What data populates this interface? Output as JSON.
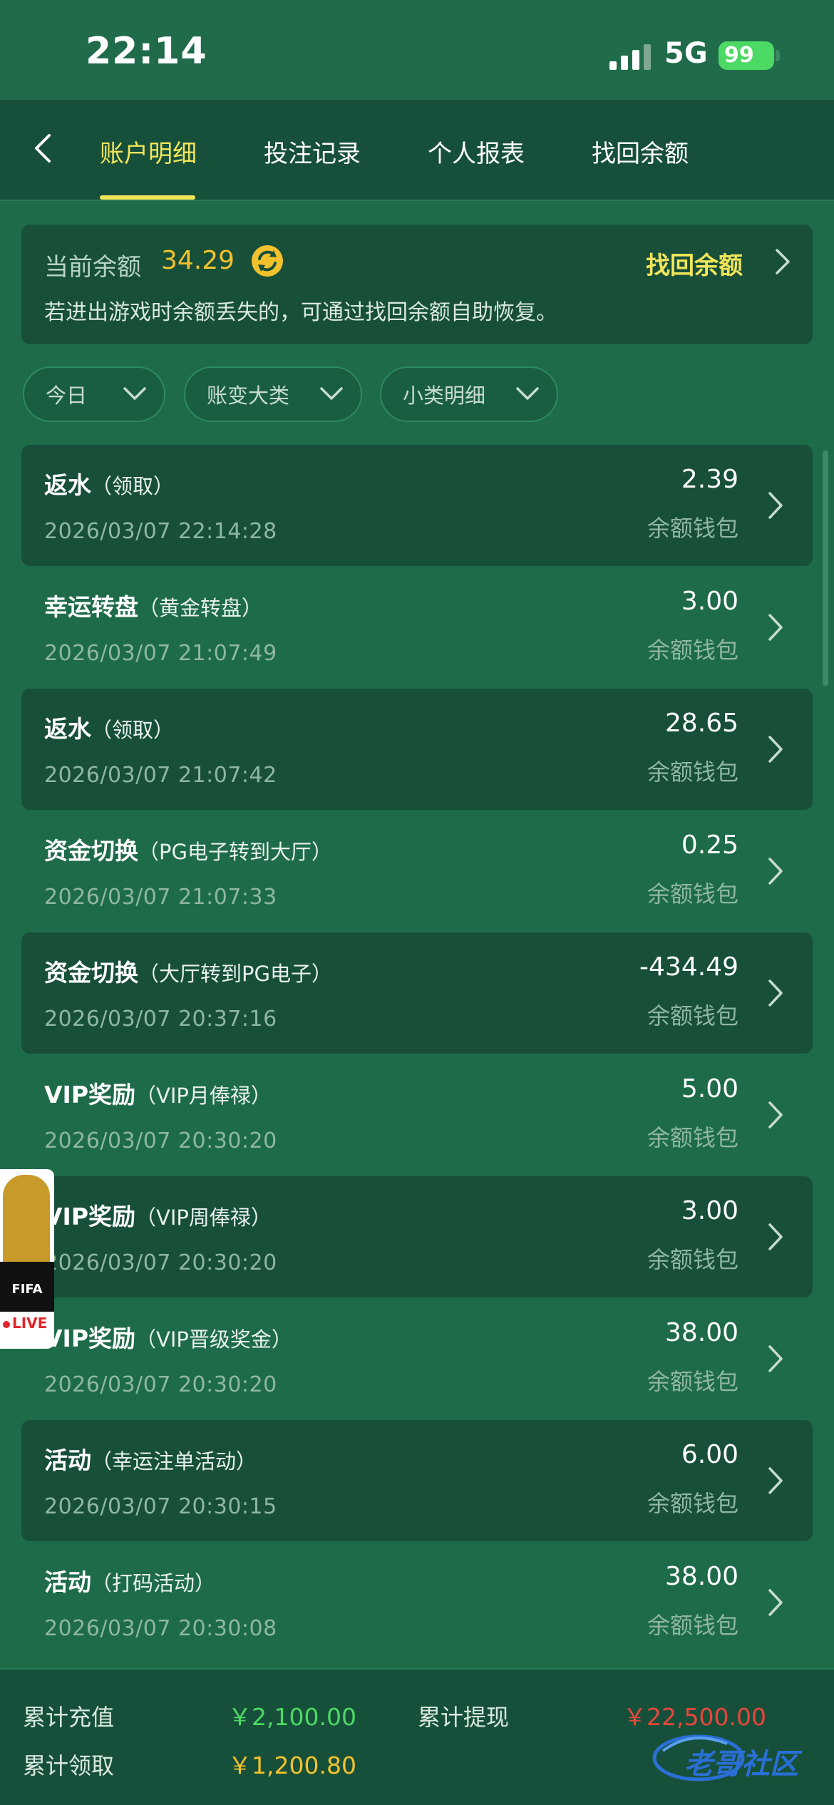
{
  "status_bar": {
    "time": "22:14",
    "network": "5G",
    "battery": "99"
  },
  "nav": {
    "tabs": [
      {
        "label": "账户明细",
        "active": true
      },
      {
        "label": "投注记录",
        "active": false
      },
      {
        "label": "个人报表",
        "active": false
      },
      {
        "label": "找回余额",
        "active": false
      }
    ]
  },
  "balance": {
    "label": "当前余额",
    "amount": "34.29",
    "recover_label": "找回余额",
    "note": "若进出游戏时余额丢失的，可通过找回余额自助恢复。"
  },
  "filters": [
    {
      "label": "今日"
    },
    {
      "label": "账变大类"
    },
    {
      "label": "小类明细"
    }
  ],
  "records": [
    {
      "title": "返水",
      "sub": "（领取）",
      "time": "2026/03/07 22:14:28",
      "amount": "2.39",
      "wallet": "余额钱包"
    },
    {
      "title": "幸运转盘",
      "sub": "（黄金转盘）",
      "time": "2026/03/07 21:07:49",
      "amount": "3.00",
      "wallet": "余额钱包"
    },
    {
      "title": "返水",
      "sub": "（领取）",
      "time": "2026/03/07 21:07:42",
      "amount": "28.65",
      "wallet": "余额钱包"
    },
    {
      "title": "资金切换",
      "sub": "（PG电子转到大厅）",
      "time": "2026/03/07 21:07:33",
      "amount": "0.25",
      "wallet": "余额钱包"
    },
    {
      "title": "资金切换",
      "sub": "（大厅转到PG电子）",
      "time": "2026/03/07 20:37:16",
      "amount": "-434.49",
      "wallet": "余额钱包"
    },
    {
      "title": "VIP奖励",
      "sub": "（VIP月俸禄）",
      "time": "2026/03/07 20:30:20",
      "amount": "5.00",
      "wallet": "余额钱包"
    },
    {
      "title": "VIP奖励",
      "sub": "（VIP周俸禄）",
      "time": "2026/03/07 20:30:20",
      "amount": "3.00",
      "wallet": "余额钱包"
    },
    {
      "title": "VIP奖励",
      "sub": "（VIP晋级奖金）",
      "time": "2026/03/07 20:30:20",
      "amount": "38.00",
      "wallet": "余额钱包"
    },
    {
      "title": "活动",
      "sub": "（幸运注单活动）",
      "time": "2026/03/07 20:30:15",
      "amount": "6.00",
      "wallet": "余额钱包"
    },
    {
      "title": "活动",
      "sub": "（打码活动）",
      "time": "2026/03/07 20:30:08",
      "amount": "38.00",
      "wallet": "余额钱包"
    }
  ],
  "fifa_badge": {
    "text": "FIFA",
    "live": "LIVE"
  },
  "footer": {
    "deposit_label": "累计充值",
    "deposit_value": "￥2,100.00",
    "withdraw_label": "累计提现",
    "withdraw_value": "￥22,500.00",
    "claim_label": "累计领取",
    "claim_value": "￥1,200.80"
  },
  "watermark": "老哥社区",
  "colors": {
    "background": "#1e6b4a",
    "accent": "#f2e55a",
    "balance": "#f2c22e",
    "deposit": "#4cd964",
    "withdraw": "#e8463c",
    "claim": "#f2c22e"
  }
}
